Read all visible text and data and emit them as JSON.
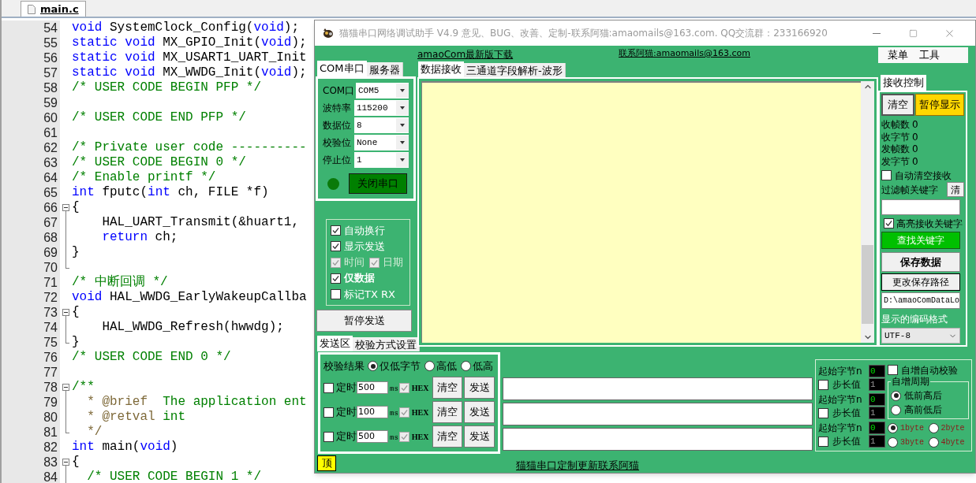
{
  "editor": {
    "tab": {
      "label": "main.c",
      "selected": true
    },
    "lines": [
      {
        "number": "54",
        "kind": "plain",
        "tokens": [
          {
            "kind": "keyword",
            "text": "void"
          },
          {
            "kind": "plain",
            "text": " SystemClock_Config("
          },
          {
            "kind": "keyword",
            "text": "void"
          },
          {
            "kind": "plain",
            "text": ");"
          }
        ]
      },
      {
        "number": "55",
        "tokens": [
          {
            "kind": "keyword",
            "text": "static void"
          },
          {
            "kind": "plain",
            "text": " MX_GPIO_Init("
          },
          {
            "kind": "keyword",
            "text": "void"
          },
          {
            "kind": "plain",
            "text": ");"
          }
        ]
      },
      {
        "number": "56",
        "tokens": [
          {
            "kind": "keyword",
            "text": "static void"
          },
          {
            "kind": "plain",
            "text": " MX_USART1_UART_Init"
          }
        ]
      },
      {
        "number": "57",
        "tokens": [
          {
            "kind": "keyword",
            "text": "static void"
          },
          {
            "kind": "plain",
            "text": " MX_WWDG_Init("
          },
          {
            "kind": "keyword",
            "text": "void"
          },
          {
            "kind": "plain",
            "text": ");"
          }
        ]
      },
      {
        "number": "58",
        "tokens": [
          {
            "kind": "comment",
            "text": "/* USER CODE BEGIN PFP */"
          }
        ]
      },
      {
        "number": "59"
      },
      {
        "number": "60",
        "tokens": [
          {
            "kind": "comment",
            "text": "/* USER CODE END PFP */"
          }
        ]
      },
      {
        "number": "61"
      },
      {
        "number": "62",
        "tokens": [
          {
            "kind": "comment",
            "text": "/* Private user code ----------"
          }
        ]
      },
      {
        "number": "63",
        "tokens": [
          {
            "kind": "comment",
            "text": "/* USER CODE BEGIN 0 */"
          }
        ]
      },
      {
        "number": "64",
        "tokens": [
          {
            "kind": "comment",
            "text": "/* Enable printf */"
          }
        ]
      },
      {
        "number": "65",
        "tokens": [
          {
            "kind": "keyword",
            "text": "int"
          },
          {
            "kind": "plain",
            "text": " fputc("
          },
          {
            "kind": "keyword",
            "text": "int"
          },
          {
            "kind": "plain",
            "text": " ch, FILE *f)"
          }
        ]
      },
      {
        "number": "66",
        "kind": "fold_start",
        "tokens": [
          {
            "kind": "plain",
            "text": "{"
          }
        ]
      },
      {
        "number": "67",
        "kind": "fold_line",
        "tokens": [
          {
            "kind": "plain",
            "text": "    HAL_UART_Transmit(&huart1,"
          }
        ]
      },
      {
        "number": "68",
        "kind": "fold_line",
        "tokens": [
          {
            "kind": "keyword",
            "text": "    return"
          },
          {
            "kind": "plain",
            "text": " ch;"
          }
        ]
      },
      {
        "number": "69",
        "kind": "fold_line",
        "tokens": [
          {
            "kind": "plain",
            "text": "}"
          }
        ]
      },
      {
        "number": "70",
        "kind": "fold_end"
      },
      {
        "number": "71",
        "tokens": [
          {
            "kind": "comment",
            "text": "/* 中断回调 */"
          }
        ]
      },
      {
        "number": "72",
        "tokens": [
          {
            "kind": "keyword",
            "text": "void"
          },
          {
            "kind": "plain",
            "text": " HAL_WWDG_EarlyWakeupCallba"
          }
        ]
      },
      {
        "number": "73",
        "kind": "fold_start",
        "tokens": [
          {
            "kind": "plain",
            "text": "{"
          }
        ]
      },
      {
        "number": "74",
        "kind": "fold_line",
        "tokens": [
          {
            "kind": "plain",
            "text": "    HAL_WWDG_Refresh(hwwdg);"
          }
        ]
      },
      {
        "number": "75",
        "kind": "fold_end",
        "tokens": [
          {
            "kind": "plain",
            "text": "}"
          }
        ]
      },
      {
        "number": "76",
        "tokens": [
          {
            "kind": "comment",
            "text": "/* USER CODE END 0 */"
          }
        ]
      },
      {
        "number": "77"
      },
      {
        "number": "78",
        "kind": "fold_start",
        "tokens": [
          {
            "kind": "comment",
            "text": "/**"
          }
        ]
      },
      {
        "number": "79",
        "kind": "fold_line",
        "tokens": [
          {
            "kind": "doc",
            "text": "  * @brief  "
          },
          {
            "kind": "comment",
            "text": "The application ent"
          }
        ]
      },
      {
        "number": "80",
        "kind": "fold_line",
        "tokens": [
          {
            "kind": "doc",
            "text": "  * @retval "
          },
          {
            "kind": "comment",
            "text": "int"
          }
        ]
      },
      {
        "number": "81",
        "kind": "fold_end",
        "tokens": [
          {
            "kind": "doc",
            "text": "  */"
          }
        ]
      },
      {
        "number": "82",
        "tokens": [
          {
            "kind": "keyword",
            "text": "int"
          },
          {
            "kind": "plain",
            "text": " main("
          },
          {
            "kind": "keyword",
            "text": "void"
          },
          {
            "kind": "plain",
            "text": ")"
          }
        ]
      },
      {
        "number": "83",
        "kind": "fold_start",
        "tokens": [
          {
            "kind": "plain",
            "text": "{"
          }
        ]
      },
      {
        "number": "84",
        "kind": "fold_line",
        "tokens": [
          {
            "kind": "comment",
            "text": "  /* USER CODE BEGIN 1 */"
          }
        ]
      }
    ]
  },
  "window": {
    "title": "猫猫串口网络调试助手 V4.9 意见、BUG、改善、定制-联系阿猫:amaomails@163.com. QQ交流群：233166920",
    "top_links": [
      "amaoCom最新版下载",
      "联系阿猫:amaomails@163.com"
    ],
    "menu": [
      "菜单",
      "工具"
    ],
    "left_tabs": [
      {
        "label": "COM串口",
        "selected": true
      },
      {
        "label": "服务器",
        "selected": false
      }
    ],
    "port_settings": [
      {
        "label": "COM口",
        "value": "COM5"
      },
      {
        "label": "波特率",
        "value": "115200"
      },
      {
        "label": "数据位",
        "value": "8"
      },
      {
        "label": "校验位",
        "value": "None"
      },
      {
        "label": "停止位",
        "value": "1"
      }
    ],
    "port_indicator": {
      "on": true
    },
    "port_button": "关闭串口",
    "display_options": [
      {
        "items": [
          {
            "label": "自动换行",
            "checked": true,
            "disabled": false,
            "bold": false
          }
        ]
      },
      {
        "items": [
          {
            "label": "显示发送",
            "checked": true,
            "disabled": false,
            "bold": false
          }
        ]
      },
      {
        "items": [
          {
            "label": "时间",
            "checked": true,
            "disabled": true,
            "bold": false
          },
          {
            "label": "日期",
            "checked": true,
            "disabled": true,
            "bold": false
          }
        ]
      },
      {
        "items": [
          {
            "label": "仅数据",
            "checked": true,
            "disabled": false,
            "bold": true
          }
        ]
      },
      {
        "items": [
          {
            "label": "标记TX RX",
            "checked": false,
            "disabled": false,
            "bold": false
          }
        ]
      }
    ],
    "pause_send_button": "暂停发送",
    "receive_tabs": [
      {
        "label": "数据接收",
        "selected": true
      },
      {
        "label": "三通道字段解析-波形",
        "selected": false
      }
    ],
    "receive_control": {
      "tab": {
        "label": "接收控制",
        "selected": true
      },
      "clear_button": "清空",
      "pause_button": "暂停显示",
      "counters": [
        {
          "label": "收帧数",
          "value": "0"
        },
        {
          "label": "收字节",
          "value": "0"
        },
        {
          "label": "发帧数",
          "value": "0"
        },
        {
          "label": "发字节",
          "value": "0"
        }
      ],
      "auto_clear": {
        "label": "自动清空接收",
        "checked": false
      },
      "filter_label": "过滤帧关键字",
      "filter_clear_button": "清",
      "highlight": {
        "label": "高亮接收关键字",
        "checked": true
      },
      "find_button": "查找关键字",
      "save_button": "保存数据",
      "change_path_button": "更改保存路径",
      "save_path": "D:\\amaoComDataLo",
      "encoding_label": "显示的编码格式",
      "encoding": "UTF-8"
    },
    "send_tabs": [
      {
        "label": "发送区",
        "selected": true
      },
      {
        "label": "校验方式设置",
        "selected": false
      }
    ],
    "checksum": {
      "label": "校验结果",
      "options": [
        {
          "label": "仅低字节",
          "selected": true
        },
        {
          "label": "高低",
          "selected": false
        },
        {
          "label": "低高",
          "selected": false
        }
      ]
    },
    "send_rows": [
      {
        "timer_checked": false,
        "timer_label": "定时",
        "interval": "500",
        "unit": "ms",
        "hex_checked": true,
        "hex_disabled": true,
        "hex_label": "HEX",
        "clear_button": "清空",
        "send_button": "发送"
      },
      {
        "timer_checked": false,
        "timer_label": "定时",
        "interval": "100",
        "unit": "ms",
        "hex_checked": true,
        "hex_disabled": true,
        "hex_label": "HEX",
        "clear_button": "清空",
        "send_button": "发送"
      },
      {
        "timer_checked": false,
        "timer_label": "定时",
        "interval": "500",
        "unit": "ms",
        "hex_checked": true,
        "hex_disabled": true,
        "hex_label": "HEX",
        "clear_button": "清空",
        "send_button": "发送"
      }
    ],
    "increment": {
      "rows": [
        {
          "start_label": "起始字节n",
          "start": "0",
          "step_checked": false,
          "step_label": "步长值",
          "step": "1"
        },
        {
          "start_label": "起始字节n",
          "start": "0",
          "step_checked": false,
          "step_label": "步长值",
          "step": "1"
        },
        {
          "start_label": "起始字节n",
          "start": "0",
          "step_checked": false,
          "step_label": "步长值",
          "step": "1"
        }
      ],
      "auto_check": {
        "label": "自增自动校验",
        "checked": false
      },
      "period": {
        "title": "自增周期",
        "options": [
          {
            "label": "低前高后",
            "selected": true
          },
          {
            "label": "高前低后",
            "selected": false
          }
        ]
      },
      "sizes": [
        {
          "label": "1byte",
          "selected": true
        },
        {
          "label": "2byte",
          "selected": false
        },
        {
          "label": "3byte",
          "selected": false
        },
        {
          "label": "4byte",
          "selected": false
        }
      ]
    },
    "top_button": "顶",
    "footer_link": "猫猫串口定制更新联系阿猫"
  }
}
